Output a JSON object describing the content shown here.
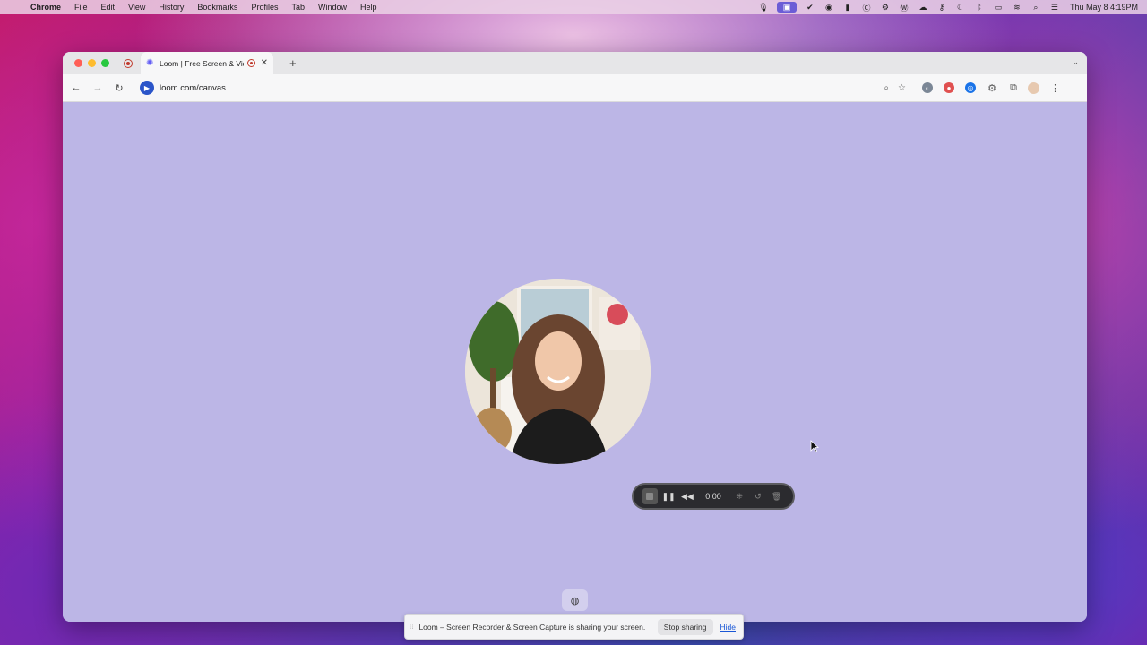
{
  "menubar": {
    "app_name": "Chrome",
    "items": [
      "File",
      "Edit",
      "View",
      "History",
      "Bookmarks",
      "Profiles",
      "Tab",
      "Window",
      "Help"
    ],
    "clock": "Thu May 8  4:19PM"
  },
  "browser": {
    "tab": {
      "title": "Loom | Free Screen & Vid"
    },
    "url": "loom.com/canvas"
  },
  "recording_controls": {
    "timer": "0:00"
  },
  "share_bar": {
    "message": "Loom – Screen Recorder & Screen Capture is sharing your screen.",
    "stop_label": "Stop sharing",
    "hide_label": "Hide"
  },
  "colors": {
    "canvas_background": "#bcb6e6",
    "loom_accent": "#625df5",
    "recording_red": "#c0392b"
  }
}
